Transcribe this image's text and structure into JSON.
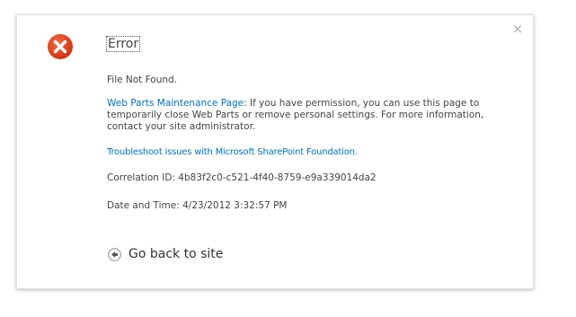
{
  "dialog": {
    "title": "Error",
    "close_glyph": "×",
    "message": "File Not Found.",
    "maintenance_link": "Web Parts Maintenance Page",
    "maintenance_text": ": If you have permission, you can use this page to temporarily close Web Parts or remove personal settings. For more information, contact your site administrator.",
    "troubleshoot_link": "Troubleshoot issues with Microsoft SharePoint Foundation.",
    "correlation": "Correlation ID: 4b83f2c0-c521-4f40-8759-e9a339014da2",
    "datetime": "Date and Time: 4/23/2012 3:32:57 PM",
    "back_label": "Go back to site"
  },
  "icons": {
    "error": "error-x-icon",
    "close": "close-icon",
    "back": "back-arrow-icon"
  },
  "colors": {
    "error_red": "#e0481f",
    "link_blue": "#0072bc",
    "text_gray": "#444444"
  }
}
